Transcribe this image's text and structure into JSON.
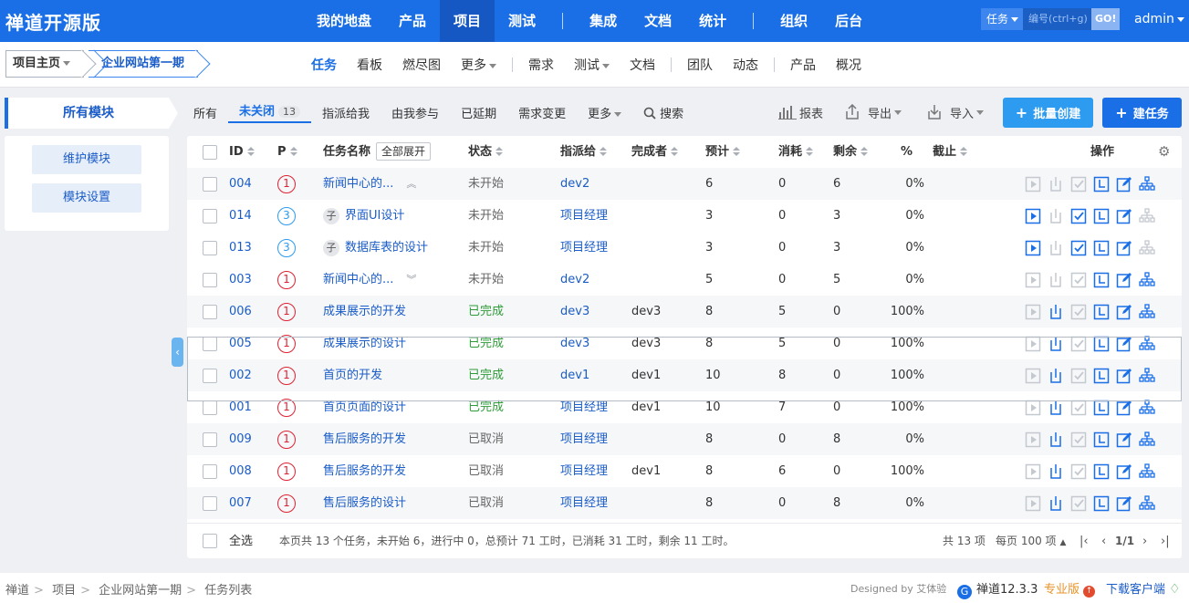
{
  "brand": "禅道开源版",
  "main_nav": [
    "我的地盘",
    "产品",
    "项目",
    "测试",
    "集成",
    "文档",
    "统计",
    "组织",
    "后台"
  ],
  "main_nav_active": "项目",
  "search": {
    "type": "任务",
    "placeholder": "编号(ctrl+g)",
    "go": "GO!"
  },
  "user": "admin",
  "breadcrumb": {
    "home": "项目主页",
    "project": "企业网站第一期"
  },
  "sub_nav": [
    "任务",
    "看板",
    "燃尽图",
    "更多",
    "需求",
    "测试",
    "文档",
    "团队",
    "动态",
    "产品",
    "概况"
  ],
  "sub_nav_active": "任务",
  "sidebar": {
    "heading": "所有模块",
    "buttons": [
      "维护模块",
      "模块设置"
    ]
  },
  "filters": {
    "all": "所有",
    "unclosed": "未关闭",
    "unclosed_count": "13",
    "assigned_to_me": "指派给我",
    "involved": "由我参与",
    "delayed": "已延期",
    "story_changed": "需求变更",
    "more": "更多",
    "search": "搜索"
  },
  "toolbar": {
    "report": "报表",
    "export": "导出",
    "import": "导入",
    "batch_create": "批量创建",
    "create": "建任务"
  },
  "table": {
    "headers": {
      "id": "ID",
      "pri": "P",
      "name": "任务名称",
      "expand_all": "全部展开",
      "status": "状态",
      "assigned": "指派给",
      "finished_by": "完成者",
      "estimate": "预计",
      "consumed": "消耗",
      "left": "剩余",
      "progress": "%",
      "deadline": "截止",
      "actions": "操作"
    },
    "rows": [
      {
        "id": "004",
        "pri": "1",
        "name": "新闻中心的...",
        "child": false,
        "fold": "up",
        "status": "未开始",
        "assigned": "dev2",
        "finished_by": "",
        "estimate": "6",
        "consumed": "0",
        "left": "6",
        "progress": "0%"
      },
      {
        "id": "014",
        "pri": "3",
        "name": "界面UI设计",
        "child": true,
        "child_tag": "子",
        "status": "未开始",
        "assigned": "项目经理",
        "finished_by": "",
        "estimate": "3",
        "consumed": "0",
        "left": "3",
        "progress": "0%"
      },
      {
        "id": "013",
        "pri": "3",
        "name": "数据库表的设计",
        "child": true,
        "child_tag": "子",
        "status": "未开始",
        "assigned": "项目经理",
        "finished_by": "",
        "estimate": "3",
        "consumed": "0",
        "left": "3",
        "progress": "0%"
      },
      {
        "id": "003",
        "pri": "1",
        "name": "新闻中心的...",
        "child": false,
        "fold": "down",
        "status": "未开始",
        "assigned": "dev2",
        "finished_by": "",
        "estimate": "5",
        "consumed": "0",
        "left": "5",
        "progress": "0%"
      },
      {
        "id": "006",
        "pri": "1",
        "name": "成果展示的开发",
        "child": false,
        "status": "已完成",
        "assigned": "dev3",
        "finished_by": "dev3",
        "estimate": "8",
        "consumed": "5",
        "left": "0",
        "progress": "100%"
      },
      {
        "id": "005",
        "pri": "1",
        "name": "成果展示的设计",
        "child": false,
        "status": "已完成",
        "assigned": "dev3",
        "finished_by": "dev3",
        "estimate": "8",
        "consumed": "5",
        "left": "0",
        "progress": "100%"
      },
      {
        "id": "002",
        "pri": "1",
        "name": "首页的开发",
        "child": false,
        "status": "已完成",
        "assigned": "dev1",
        "finished_by": "dev1",
        "estimate": "10",
        "consumed": "8",
        "left": "0",
        "progress": "100%"
      },
      {
        "id": "001",
        "pri": "1",
        "name": "首页页面的设计",
        "child": false,
        "status": "已完成",
        "assigned": "项目经理",
        "finished_by": "dev1",
        "estimate": "10",
        "consumed": "7",
        "left": "0",
        "progress": "100%"
      },
      {
        "id": "009",
        "pri": "1",
        "name": "售后服务的开发",
        "child": false,
        "status": "已取消",
        "assigned": "项目经理",
        "finished_by": "",
        "estimate": "8",
        "consumed": "0",
        "left": "8",
        "progress": "0%"
      },
      {
        "id": "008",
        "pri": "1",
        "name": "售后服务的开发",
        "child": false,
        "status": "已取消",
        "assigned": "项目经理",
        "finished_by": "dev1",
        "estimate": "8",
        "consumed": "6",
        "left": "0",
        "progress": "100%"
      },
      {
        "id": "007",
        "pri": "1",
        "name": "售后服务的设计",
        "child": false,
        "status": "已取消",
        "assigned": "项目经理",
        "finished_by": "",
        "estimate": "8",
        "consumed": "0",
        "left": "8",
        "progress": "0%"
      }
    ]
  },
  "table_footer": {
    "select_all": "全选",
    "summary": "本页共 13 个任务，未开始 6，进行中 0，总预计 71 工时，已消耗 31 工时，剩余 11 工时。",
    "total": "共 13 项",
    "per_page": "每页 100 项",
    "page": "1/1"
  },
  "page_footer": {
    "trail": [
      "禅道",
      "项目",
      "企业网站第一期",
      "任务列表"
    ],
    "designed_by": "Designed by",
    "designer": "艾体验",
    "version": "禅道12.3.3",
    "edition": "专业版",
    "download": "下载客户端"
  },
  "colors": {
    "primary": "#1a6fe6",
    "done": "#2e9b39",
    "priority_high": "#dd2233",
    "priority_low": "#2d9bf0"
  }
}
